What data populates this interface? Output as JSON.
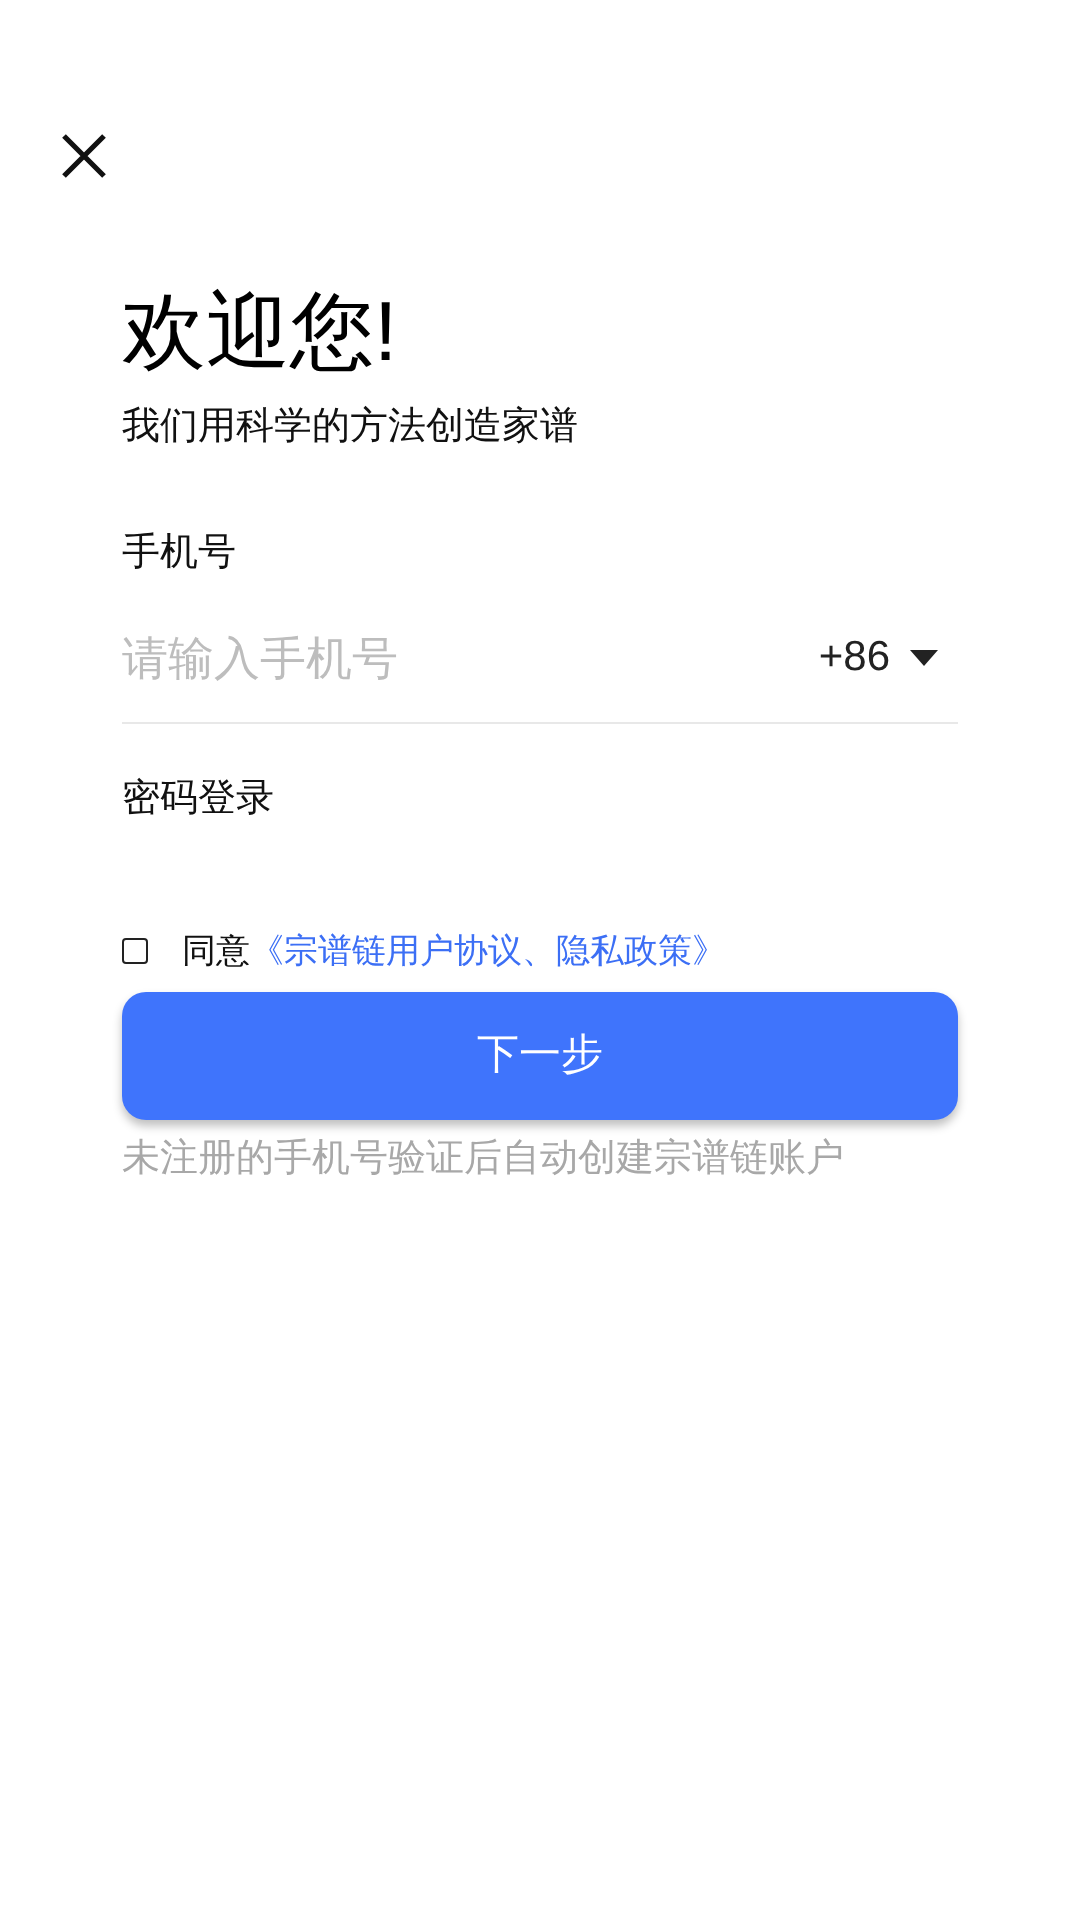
{
  "title": "欢迎您!",
  "subtitle": "我们用科学的方法创造家谱",
  "phone": {
    "label": "手机号",
    "placeholder": "请输入手机号",
    "country_code": "+86"
  },
  "password_login": "密码登录",
  "agreement": {
    "checked": false,
    "text": "同意",
    "link": "《宗谱链用户协议、隐私政策》"
  },
  "next_button": "下一步",
  "note": "未注册的手机号验证后自动创建宗谱链账户"
}
